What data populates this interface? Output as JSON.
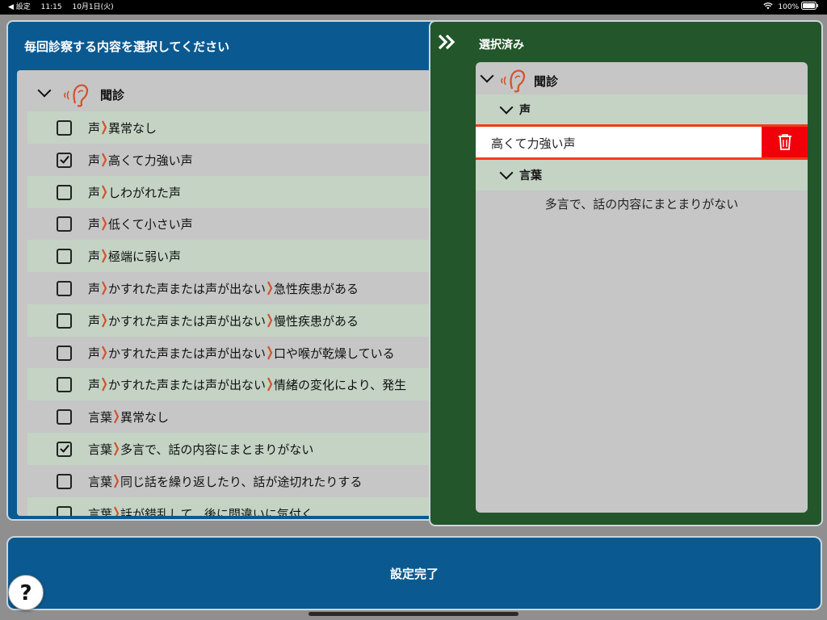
{
  "statusbar": {
    "back": "◀ 設定",
    "time": "11:15",
    "date": "10月1日(火)",
    "battery": "100%"
  },
  "left": {
    "title": "毎回診察する内容を選択してください",
    "group_label": "聞診",
    "rows": [
      {
        "parts": [
          "声",
          "異常なし"
        ],
        "checked": false
      },
      {
        "parts": [
          "声",
          "高くて力強い声"
        ],
        "checked": true
      },
      {
        "parts": [
          "声",
          "しわがれた声"
        ],
        "checked": false
      },
      {
        "parts": [
          "声",
          "低くて小さい声"
        ],
        "checked": false
      },
      {
        "parts": [
          "声",
          "極端に弱い声"
        ],
        "checked": false
      },
      {
        "parts": [
          "声",
          "かすれた声または声が出ない",
          "急性疾患がある"
        ],
        "checked": false
      },
      {
        "parts": [
          "声",
          "かすれた声または声が出ない",
          "慢性疾患がある"
        ],
        "checked": false
      },
      {
        "parts": [
          "声",
          "かすれた声または声が出ない",
          "口や喉が乾燥している"
        ],
        "checked": false
      },
      {
        "parts": [
          "声",
          "かすれた声または声が出ない",
          "情緒の変化により、発生"
        ],
        "checked": false
      },
      {
        "parts": [
          "言葉",
          "異常なし"
        ],
        "checked": false
      },
      {
        "parts": [
          "言葉",
          "多言で、話の内容にまとまりがない"
        ],
        "checked": true
      },
      {
        "parts": [
          "言葉",
          "同じ話を繰り返したり、話が途切れたりする"
        ],
        "checked": false
      },
      {
        "parts": [
          "言葉",
          "話が錯乱して、後に間違いに気付く"
        ],
        "checked": false
      }
    ]
  },
  "right": {
    "title": "選択済み",
    "group_label": "聞診",
    "sub1": "声",
    "item1": "高くて力強い声",
    "sub2": "言葉",
    "item2": "多言で、話の内容にまとまりがない"
  },
  "footer": {
    "done_label": "設定完了"
  },
  "help_label": "?",
  "colors": {
    "blue": "#0a5a91",
    "green": "#23562b",
    "accent": "#d2522a",
    "delete": "#f2000a"
  }
}
